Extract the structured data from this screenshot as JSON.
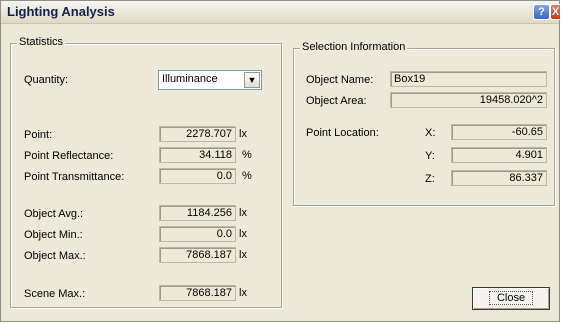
{
  "window": {
    "title": "Lighting Analysis",
    "help_label": "?",
    "close_label": "X"
  },
  "statistics": {
    "legend": "Statistics",
    "quantity_label": "Quantity:",
    "quantity_value": "Illuminance",
    "point_label": "Point:",
    "point_value": "2278.707",
    "point_unit": "lx",
    "reflectance_label": "Point Reflectance:",
    "reflectance_value": "34.118",
    "reflectance_unit": "%",
    "transmittance_label": "Point Transmittance:",
    "transmittance_value": "0.0",
    "transmittance_unit": "%",
    "obj_avg_label": "Object  Avg.:",
    "obj_avg_value": "1184.256",
    "obj_avg_unit": "lx",
    "obj_min_label": "Object Min.:",
    "obj_min_value": "0.0",
    "obj_min_unit": "lx",
    "obj_max_label": "Object Max.:",
    "obj_max_value": "7868.187",
    "obj_max_unit": "lx",
    "scene_max_label": "Scene Max.:",
    "scene_max_value": "7868.187",
    "scene_max_unit": "lx"
  },
  "selection": {
    "legend": "Selection Information",
    "name_label": "Object Name:",
    "name_value": "Box19",
    "area_label": "Object Area:",
    "area_value": "19458.020^2",
    "location_label": "Point Location:",
    "x_label": "X:",
    "x_value": "-60.65",
    "y_label": "Y:",
    "y_value": "4.901",
    "z_label": "Z:",
    "z_value": "86.337"
  },
  "buttons": {
    "close_label": "Close"
  }
}
